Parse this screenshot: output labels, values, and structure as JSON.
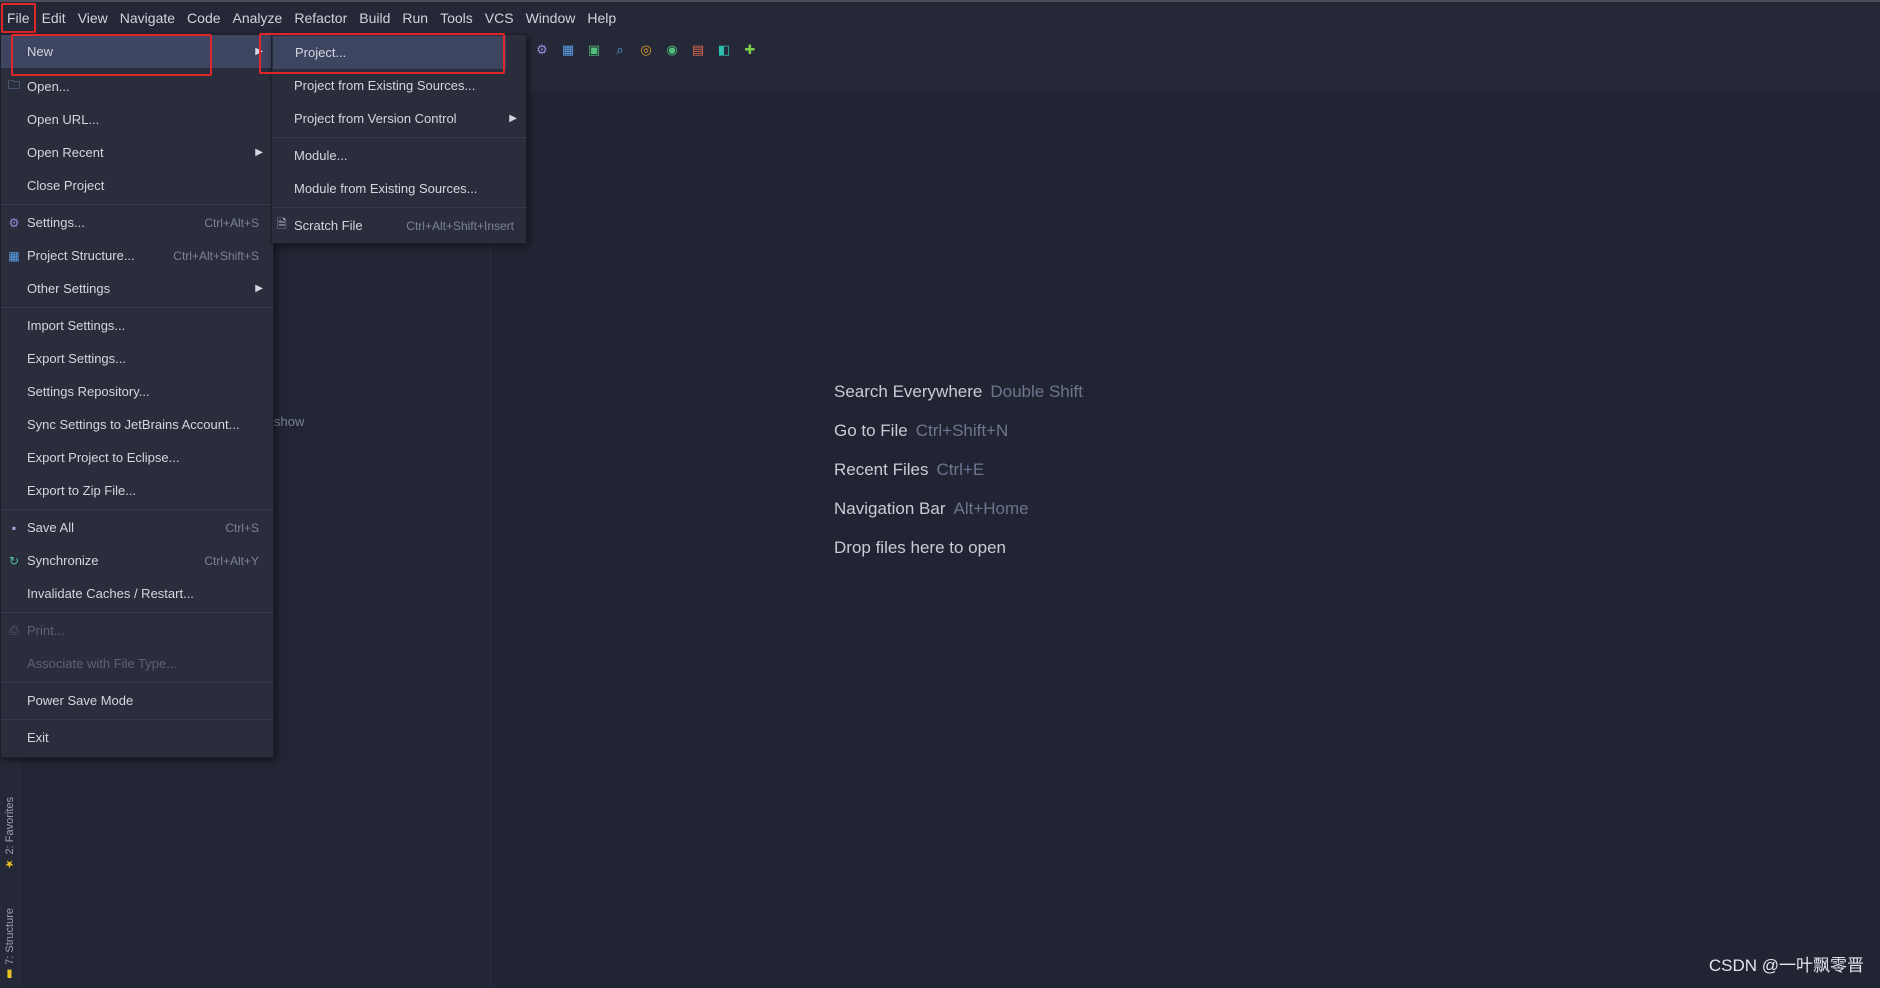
{
  "menubar": {
    "items": [
      "File",
      "Edit",
      "View",
      "Navigate",
      "Code",
      "Analyze",
      "Refactor",
      "Build",
      "Run",
      "Tools",
      "VCS",
      "Window",
      "Help"
    ]
  },
  "file_menu": {
    "items": [
      {
        "label": "New",
        "shortcut": "",
        "icon": "",
        "submenu": true,
        "selected": true
      },
      {
        "label": "Open...",
        "shortcut": "",
        "icon": "folder-icon"
      },
      {
        "label": "Open URL...",
        "shortcut": "",
        "icon": ""
      },
      {
        "label": "Open Recent",
        "shortcut": "",
        "icon": "",
        "submenu": true
      },
      {
        "label": "Close Project",
        "shortcut": "",
        "icon": ""
      },
      {
        "label": "Settings...",
        "shortcut": "Ctrl+Alt+S",
        "icon": "gear-icon"
      },
      {
        "label": "Project Structure...",
        "shortcut": "Ctrl+Alt+Shift+S",
        "icon": "grid-icon"
      },
      {
        "label": "Other Settings",
        "shortcut": "",
        "icon": "",
        "submenu": true
      },
      {
        "label": "Import Settings...",
        "shortcut": "",
        "icon": ""
      },
      {
        "label": "Export Settings...",
        "shortcut": "",
        "icon": ""
      },
      {
        "label": "Settings Repository...",
        "shortcut": "",
        "icon": ""
      },
      {
        "label": "Sync Settings to JetBrains Account...",
        "shortcut": "",
        "icon": ""
      },
      {
        "label": "Export Project to Eclipse...",
        "shortcut": "",
        "icon": ""
      },
      {
        "label": "Export to Zip File...",
        "shortcut": "",
        "icon": ""
      },
      {
        "label": "Save All",
        "shortcut": "Ctrl+S",
        "icon": "save-icon"
      },
      {
        "label": "Synchronize",
        "shortcut": "Ctrl+Alt+Y",
        "icon": "sync-icon"
      },
      {
        "label": "Invalidate Caches / Restart...",
        "shortcut": "",
        "icon": ""
      },
      {
        "label": "Print...",
        "shortcut": "",
        "icon": "print-icon",
        "disabled": true
      },
      {
        "label": "Associate with File Type...",
        "shortcut": "",
        "icon": "",
        "disabled": true
      },
      {
        "label": "Power Save Mode",
        "shortcut": "",
        "icon": ""
      },
      {
        "label": "Exit",
        "shortcut": "",
        "icon": ""
      }
    ]
  },
  "new_submenu": {
    "items": [
      {
        "label": "Project...",
        "shortcut": "",
        "selected": true
      },
      {
        "label": "Project from Existing Sources...",
        "shortcut": ""
      },
      {
        "label": "Project from Version Control",
        "shortcut": "",
        "submenu": true
      },
      {
        "label": "Module...",
        "shortcut": ""
      },
      {
        "label": "Module from Existing Sources...",
        "shortcut": ""
      },
      {
        "label": "Scratch File",
        "shortcut": "Ctrl+Alt+Shift+Insert",
        "icon": "scratch-file-icon"
      }
    ]
  },
  "side_tabs": {
    "favorites": "2: Favorites",
    "structure": "7: Structure"
  },
  "project_panel": {
    "hint": "show"
  },
  "editor_hints": [
    {
      "label": "Search Everywhere",
      "key": "Double Shift"
    },
    {
      "label": "Go to File",
      "key": "Ctrl+Shift+N"
    },
    {
      "label": "Recent Files",
      "key": "Ctrl+E"
    },
    {
      "label": "Navigation Bar",
      "key": "Alt+Home"
    },
    {
      "label": "Drop files here to open",
      "key": ""
    }
  ],
  "watermark": "CSDN @一叶飘零晋",
  "colors": {
    "highlight_box": "#e0262b",
    "selection": "#3d4560",
    "background": "#222534"
  }
}
